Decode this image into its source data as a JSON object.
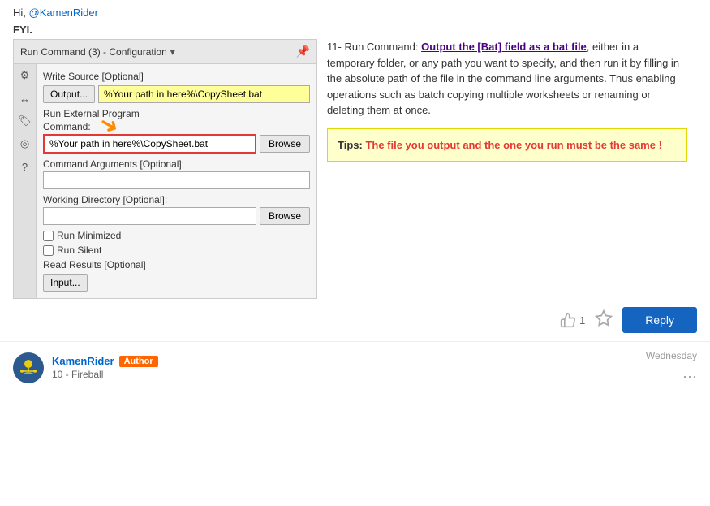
{
  "greeting": {
    "text": "Hi, ",
    "username": "@KamenRider",
    "fyi": "FYI."
  },
  "config": {
    "title": "Run Command (3) - Configuration",
    "pin_icon": "📌",
    "icons": [
      "gear",
      "arrow-left-right",
      "tag",
      "circle",
      "question"
    ],
    "write_source": {
      "label": "Write Source [Optional]",
      "output_btn": "Output...",
      "input_value": "%Your path in here%\\CopySheet.bat"
    },
    "run_external": {
      "label": "Run External Program",
      "command_label": "Command:",
      "command_value": "%Your path in here%\\CopySheet.bat",
      "browse_label": "Browse"
    },
    "command_args": {
      "label": "Command Arguments [Optional]:",
      "value": ""
    },
    "working_dir": {
      "label": "Working Directory [Optional]:",
      "value": "",
      "browse_label": "Browse"
    },
    "checkboxes": {
      "run_minimized": "Run Minimized",
      "run_silent": "Run Silent"
    },
    "read_results": {
      "label": "Read Results [Optional]",
      "input_btn": "Input..."
    }
  },
  "content": {
    "step_number": "11-",
    "step_text_prefix": " Run Command: ",
    "step_highlight": "Output the [Bat] field as a bat file",
    "step_text_body": ", either in a temporary folder, or any path you want to specify, and then run it by filling in the absolute path of the file in the command line arguments. Thus enabling operations such as batch copying multiple worksheets or renaming or deleting them at once.",
    "tip": {
      "label": "Tips:",
      "text": " The file you output and the one you run must be the same !"
    }
  },
  "actions": {
    "like_count": "1",
    "reply_label": "Reply"
  },
  "user": {
    "name": "KamenRider",
    "badge": "Author",
    "rank": "10 - Fireball",
    "timestamp": "Wednesday",
    "more": "..."
  },
  "icons_map": {
    "gear": "⚙",
    "arrow-left-right": "↔",
    "tag": "🏷",
    "circle": "◎",
    "question": "?"
  }
}
